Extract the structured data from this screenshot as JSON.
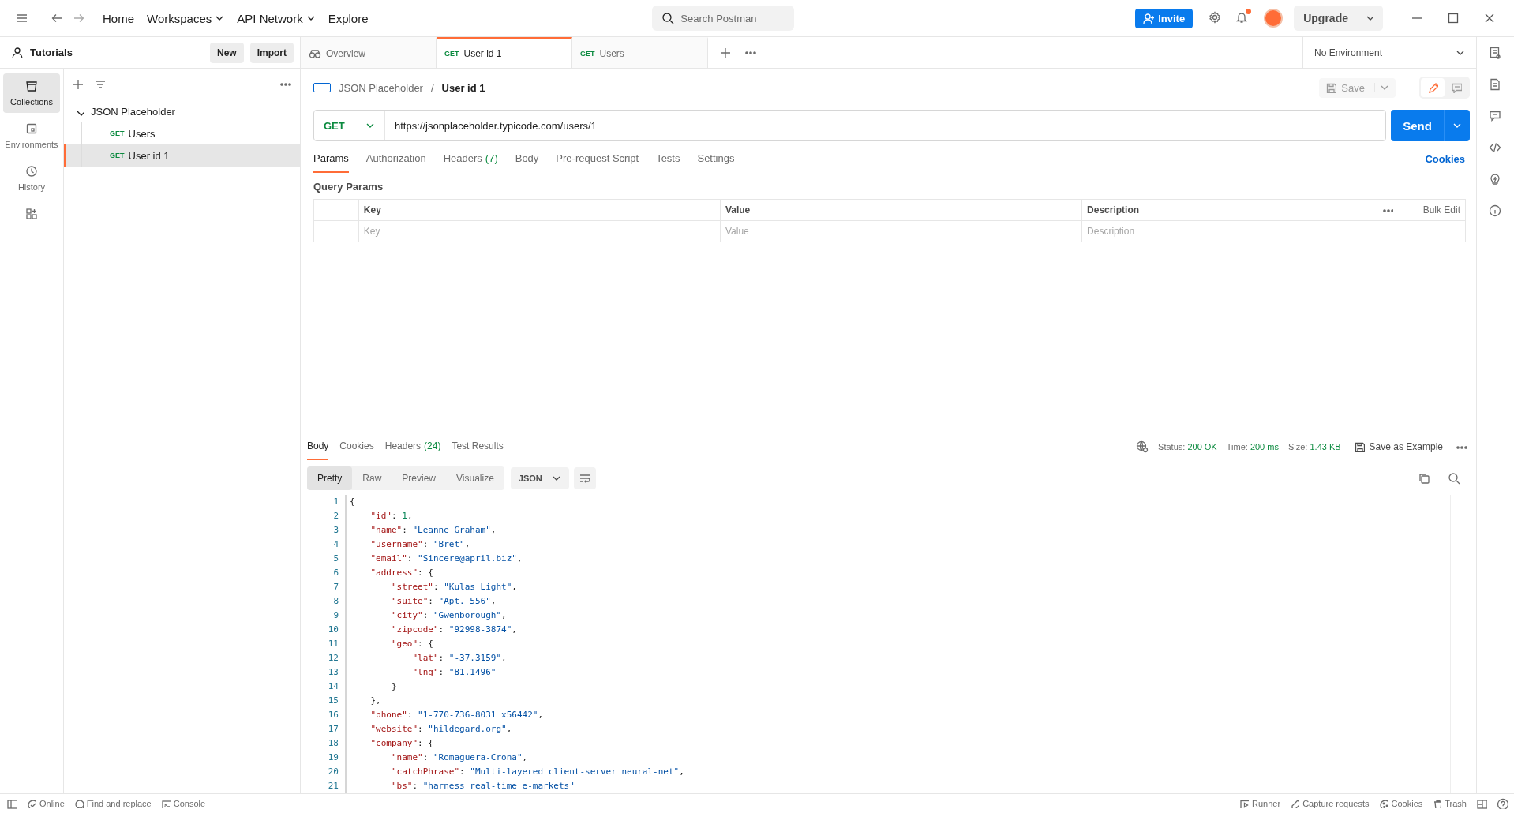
{
  "top_bar": {
    "nav": [
      {
        "label": "Home",
        "dropdown": false
      },
      {
        "label": "Workspaces",
        "dropdown": true
      },
      {
        "label": "API Network",
        "dropdown": true
      },
      {
        "label": "Explore",
        "dropdown": false
      }
    ],
    "search": {
      "placeholder": "Search Postman"
    },
    "invite": "Invite",
    "upgrade": "Upgrade",
    "notification_dot": true
  },
  "sidebar": {
    "workspace": "Tutorials",
    "new_button": "New",
    "import_button": "Import",
    "rail": [
      {
        "kind": "collections",
        "label": "Collections",
        "selected": true
      },
      {
        "kind": "environments",
        "label": "Environments",
        "selected": false
      },
      {
        "kind": "history",
        "label": "History",
        "selected": false
      },
      {
        "kind": "apps",
        "selected": false
      }
    ],
    "tree": [
      {
        "name": "JSON Placeholder",
        "expanded": true,
        "children": [
          {
            "method": "GET",
            "name": "Users",
            "selected": false
          },
          {
            "method": "GET",
            "name": "User id 1",
            "selected": true
          }
        ]
      }
    ]
  },
  "tabs": [
    {
      "kind": "overview",
      "label": "Overview",
      "selected": false
    },
    {
      "kind": "request",
      "method": "GET",
      "label": "User id 1",
      "selected": true
    },
    {
      "kind": "request",
      "method": "GET",
      "label": "Users",
      "selected": false
    }
  ],
  "environment": "No Environment",
  "request": {
    "breadcrumb": [
      "JSON Placeholder",
      "User id 1"
    ],
    "separator": "/",
    "save": "Save",
    "method": "GET",
    "url": "https://jsonplaceholder.typicode.com/users/1",
    "send": "Send",
    "tabs": [
      {
        "label": "Params",
        "selected": true
      },
      {
        "label": "Authorization",
        "selected": false
      },
      {
        "label": "Headers",
        "count": "(7)",
        "selected": false
      },
      {
        "label": "Body",
        "selected": false
      },
      {
        "label": "Pre-request Script",
        "selected": false
      },
      {
        "label": "Tests",
        "selected": false
      },
      {
        "label": "Settings",
        "selected": false
      }
    ],
    "cookies": "Cookies",
    "query_params_title": "Query Params",
    "params_table": {
      "columns": [
        "Key",
        "Value",
        "Description"
      ],
      "bulk_edit": "Bulk Edit",
      "placeholders": [
        "Key",
        "Value",
        "Description"
      ]
    }
  },
  "response": {
    "tabs": [
      {
        "label": "Body",
        "selected": true
      },
      {
        "label": "Cookies",
        "selected": false
      },
      {
        "label": "Headers",
        "count": "(24)",
        "selected": false
      },
      {
        "label": "Test Results",
        "selected": false
      }
    ],
    "status": [
      {
        "label": "Status:",
        "value": "200 OK"
      },
      {
        "label": "Time:",
        "value": "200 ms"
      },
      {
        "label": "Size:",
        "value": "1.43 KB"
      }
    ],
    "save_example": "Save as Example",
    "views": [
      {
        "label": "Pretty",
        "selected": true
      },
      {
        "label": "Raw",
        "selected": false
      },
      {
        "label": "Preview",
        "selected": false
      },
      {
        "label": "Visualize",
        "selected": false
      }
    ],
    "format": "JSON",
    "lines": [
      {
        "number": "1",
        "text": "{"
      },
      {
        "number": "2",
        "text": "    \"id\": 1,"
      },
      {
        "number": "3",
        "text": "    \"name\": \"Leanne Graham\","
      },
      {
        "number": "4",
        "text": "    \"username\": \"Bret\","
      },
      {
        "number": "5",
        "text": "    \"email\": \"Sincere@april.biz\","
      },
      {
        "number": "6",
        "text": "    \"address\": {"
      },
      {
        "number": "7",
        "text": "        \"street\": \"Kulas Light\","
      },
      {
        "number": "8",
        "text": "        \"suite\": \"Apt. 556\","
      },
      {
        "number": "9",
        "text": "        \"city\": \"Gwenborough\","
      },
      {
        "number": "10",
        "text": "        \"zipcode\": \"92998-3874\","
      },
      {
        "number": "11",
        "text": "        \"geo\": {"
      },
      {
        "number": "12",
        "text": "            \"lat\": \"-37.3159\","
      },
      {
        "number": "13",
        "text": "            \"lng\": \"81.1496\""
      },
      {
        "number": "14",
        "text": "        }"
      },
      {
        "number": "15",
        "text": "    },"
      },
      {
        "number": "16",
        "text": "    \"phone\": \"1-770-736-8031 x56442\","
      },
      {
        "number": "17",
        "text": "    \"website\": \"hildegard.org\","
      },
      {
        "number": "18",
        "text": "    \"company\": {"
      },
      {
        "number": "19",
        "text": "        \"name\": \"Romaguera-Crona\","
      },
      {
        "number": "20",
        "text": "        \"catchPhrase\": \"Multi-layered client-server neural-net\","
      },
      {
        "number": "21",
        "text": "        \"bs\": \"harness real-time e-markets\""
      }
    ]
  },
  "status_bar": {
    "left": [
      {
        "kind": "online",
        "label": "Online"
      },
      {
        "kind": "find",
        "label": "Find and replace"
      },
      {
        "kind": "console",
        "label": "Console"
      }
    ],
    "right": [
      {
        "kind": "runner",
        "label": "Runner"
      },
      {
        "kind": "capture",
        "label": "Capture requests"
      },
      {
        "kind": "cookies",
        "label": "Cookies"
      },
      {
        "kind": "trash",
        "label": "Trash"
      }
    ]
  }
}
